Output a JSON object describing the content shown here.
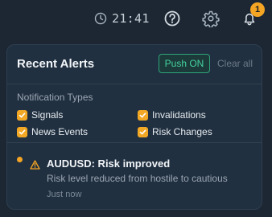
{
  "topbar": {
    "time": "21:41",
    "notification_count": "1",
    "icons": [
      "clock-icon",
      "help-icon",
      "gear-icon",
      "bell-icon"
    ]
  },
  "panel": {
    "title": "Recent Alerts",
    "push_label": "Push ON",
    "clear_label": "Clear all",
    "types_title": "Notification Types",
    "options": [
      {
        "label": "Signals",
        "checked": true
      },
      {
        "label": "Invalidations",
        "checked": true
      },
      {
        "label": "News Events",
        "checked": true
      },
      {
        "label": "Risk Changes",
        "checked": true
      }
    ],
    "alerts": [
      {
        "title": "AUDUSD: Risk improved",
        "message": "Risk level reduced from hostile to cautious",
        "time": "Just now"
      }
    ]
  },
  "colors": {
    "accent": "#f5a524",
    "push_green": "#43d39e",
    "background": "#1c2733",
    "panel": "#213040"
  }
}
